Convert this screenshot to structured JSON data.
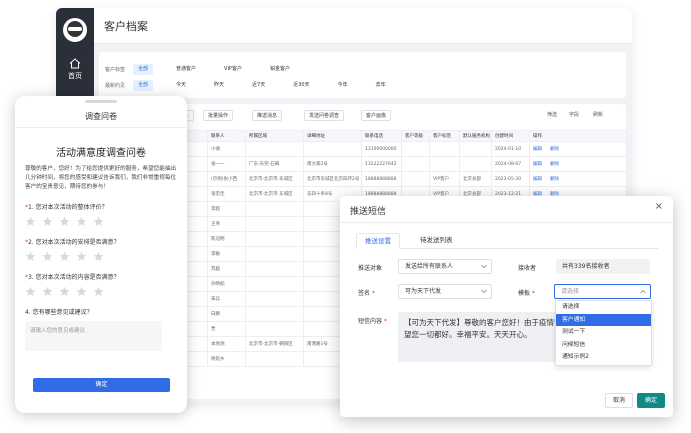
{
  "crm": {
    "title": "客户档案",
    "nav_home": "首页",
    "filters": [
      {
        "label": "客户标签",
        "options": [
          "全部",
          "普通客户",
          "VIP客户",
          "铂金客户"
        ],
        "active": 0
      },
      {
        "label": "最新约见",
        "options": [
          "全部",
          "今天",
          "昨天",
          "近7天",
          "近30天",
          "今年",
          "去年"
        ],
        "active": 0
      }
    ],
    "toolbar": {
      "buttons": [
        "...",
        "批量操作",
        "推送消息",
        "发送问卷调查",
        "客户画像"
      ],
      "tools": [
        "筛选",
        "字段",
        "刷新"
      ]
    },
    "table": {
      "columns": [
        "",
        "",
        "",
        "联系人",
        "所属区域",
        "详细地址",
        "联系电话",
        "客户等级",
        "客户标签",
        "默认服务机构",
        "创建时间",
        "操作"
      ],
      "rows": [
        [
          "",
          "",
          "",
          "小谢",
          "",
          "",
          "13100000000",
          "",
          "",
          "",
          "2024-01-10",
          ""
        ],
        [
          "",
          "",
          "",
          "张一一",
          "广东-东莞-石碣",
          "南大家2号",
          "13222227642",
          "",
          "",
          "",
          "2024-08-07",
          ""
        ],
        [
          "",
          "",
          "",
          "(示例)张小西",
          "北京市-北京市-东城区",
          "北京市东城区北京四环2号",
          "18888888888",
          "",
          "VIP客户",
          "北京总部",
          "2023-05-30",
          ""
        ],
        [
          "",
          "",
          "",
          "张宏佳",
          "北京市-北京市-东城区",
          "东四十条8号",
          "18888888888",
          "",
          "VIP客户",
          "北京总部",
          "2023-12-21",
          ""
        ],
        [
          "",
          "",
          "",
          "李超",
          "",
          "",
          "",
          "",
          "",
          "",
          "",
          ""
        ],
        [
          "",
          "",
          "",
          "王伟",
          "",
          "",
          "",
          "",
          "",
          "",
          "",
          ""
        ],
        [
          "",
          "",
          "",
          "陈冠明",
          "",
          "",
          "",
          "",
          "",
          "",
          "",
          ""
        ],
        [
          "",
          "",
          "",
          "李敏",
          "",
          "",
          "",
          "",
          "",
          "",
          "",
          ""
        ],
        [
          "",
          "",
          "",
          "苏越",
          "",
          "",
          "",
          "",
          "",
          "",
          "",
          ""
        ],
        [
          "",
          "",
          "",
          "孙晴如",
          "",
          "",
          "",
          "",
          "",
          "",
          "",
          ""
        ],
        [
          "",
          "",
          "",
          "朱兵",
          "",
          "",
          "",
          "",
          "",
          "",
          "",
          ""
        ],
        [
          "",
          "",
          "",
          "白鹏",
          "",
          "",
          "",
          "",
          "",
          "",
          "",
          ""
        ],
        [
          "",
          "",
          "",
          "贾",
          "",
          "",
          "",
          "",
          "",
          "",
          "",
          ""
        ],
        [
          "",
          "",
          "",
          "本地测",
          "北京市-北京市-朝阳区",
          "南港路1号",
          "",
          "",
          "",
          "",
          "",
          ""
        ],
        [
          "",
          "",
          "",
          "杨思乡",
          "",
          "",
          "",
          "",
          "",
          "",
          "",
          ""
        ]
      ],
      "op_edit": "编辑",
      "op_delete": "删除"
    }
  },
  "phone": {
    "header": "调查问卷",
    "survey_title": "活动满意度调查问卷",
    "intro": "尊敬的客户，您好！为了给您提供更好的服务，希望您能抽出几分钟时间，将您的感受和建议告诉我们，我们非常重视每位客户的宝贵意见，期待您的参与！",
    "questions": [
      {
        "marker": "*",
        "text": "1. 您对本次活动的整体评价？",
        "type": "stars"
      },
      {
        "marker": "*",
        "text": "2. 您对本次活动的安排是否满意？",
        "type": "stars"
      },
      {
        "marker": "*",
        "text": "3. 您对本次活动的内容是否满意？",
        "type": "stars"
      },
      {
        "marker": "",
        "text": "4. 您有哪些意见或建议？",
        "type": "text",
        "placeholder": "请输入您的意见或建议"
      }
    ],
    "submit": "确定"
  },
  "dialog": {
    "title": "推送短信",
    "tabs": [
      "推送设置",
      "待发送列表"
    ],
    "fields": {
      "target_label": "推送对象",
      "target_value": "发送给所有联系人",
      "receiver_label": "接收者",
      "receiver_value": "共有339名接收者",
      "sign_label": "签名",
      "sign_value": "可为天下代发",
      "template_label": "模板",
      "template_placeholder": "请选择",
      "content_label": "短信内容",
      "content_value": "【可为天下代发】尊敬的客户您好！由于疫情管控，希望您一切都好。幸福平安。天天开心。"
    },
    "dropdown": [
      "请选择",
      "客户通知",
      "测试一下",
      "问候短信",
      "通知示例2"
    ],
    "dropdown_selected": 1,
    "cancel": "取消",
    "ok": "确定"
  },
  "colors": {
    "primary": "#2f6ce5",
    "sidebar": "#2b2f3a",
    "ok_button": "#0f8a86",
    "required": "#e4393c"
  }
}
